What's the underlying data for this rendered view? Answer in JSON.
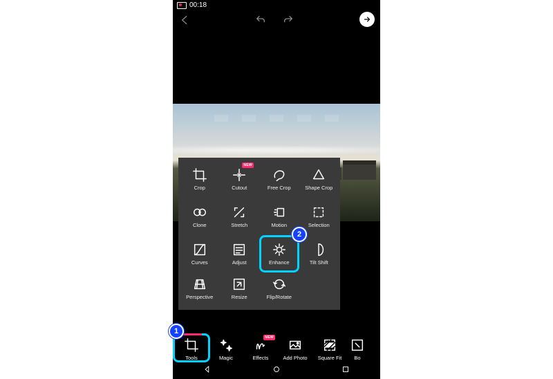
{
  "status": {
    "time": "00:18"
  },
  "panel": {
    "tools": [
      {
        "id": "crop",
        "label": "Crop"
      },
      {
        "id": "cutout",
        "label": "Cutout",
        "badge": "NEW"
      },
      {
        "id": "freecrop",
        "label": "Free Crop"
      },
      {
        "id": "shapecrop",
        "label": "Shape Crop"
      },
      {
        "id": "clone",
        "label": "Clone"
      },
      {
        "id": "stretch",
        "label": "Stretch"
      },
      {
        "id": "motion",
        "label": "Motion"
      },
      {
        "id": "selection",
        "label": "Selection"
      },
      {
        "id": "curves",
        "label": "Curves"
      },
      {
        "id": "adjust",
        "label": "Adjust"
      },
      {
        "id": "enhance",
        "label": "Enhance",
        "highlight": true
      },
      {
        "id": "tiltshift",
        "label": "Tilt Shift"
      },
      {
        "id": "perspective",
        "label": "Perspective"
      },
      {
        "id": "resize",
        "label": "Resize"
      },
      {
        "id": "fliprotate",
        "label": "Flip/Rotate"
      }
    ]
  },
  "tabs": [
    {
      "id": "tools",
      "label": "Tools",
      "active": true,
      "highlight": true
    },
    {
      "id": "magic",
      "label": "Magic"
    },
    {
      "id": "effects",
      "label": "Effects",
      "badge": "NEW"
    },
    {
      "id": "addphoto",
      "label": "Add Photo"
    },
    {
      "id": "squarefit",
      "label": "Square Fit"
    },
    {
      "id": "border",
      "label": "Bo"
    }
  ],
  "callouts": {
    "tools": "1",
    "enhance": "2"
  }
}
